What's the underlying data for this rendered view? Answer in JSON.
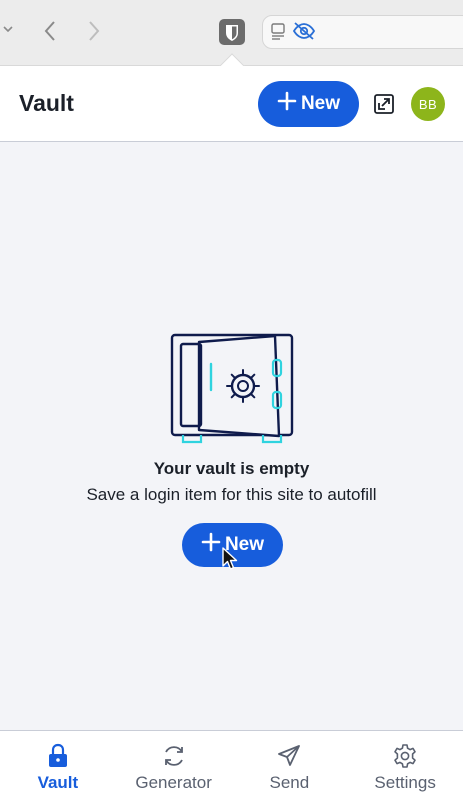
{
  "browser": {
    "icons": [
      "chevron-down-icon",
      "back-arrow-icon",
      "forward-arrow-icon",
      "bitwarden-extension-icon",
      "reader-view-icon",
      "hidden-eye-icon"
    ]
  },
  "header": {
    "title": "Vault",
    "new_label": "New",
    "avatar_initials": "BB",
    "avatar_color": "#8db51b",
    "accent": "#175ddc"
  },
  "empty": {
    "title": "Your vault is empty",
    "description": "Save a login item for this site to autofill",
    "new_label": "New"
  },
  "nav": {
    "items": [
      {
        "label": "Vault",
        "icon": "lock-icon",
        "active": true
      },
      {
        "label": "Generator",
        "icon": "refresh-icon",
        "active": false
      },
      {
        "label": "Send",
        "icon": "paper-plane-icon",
        "active": false
      },
      {
        "label": "Settings",
        "icon": "gear-icon",
        "active": false
      }
    ]
  }
}
